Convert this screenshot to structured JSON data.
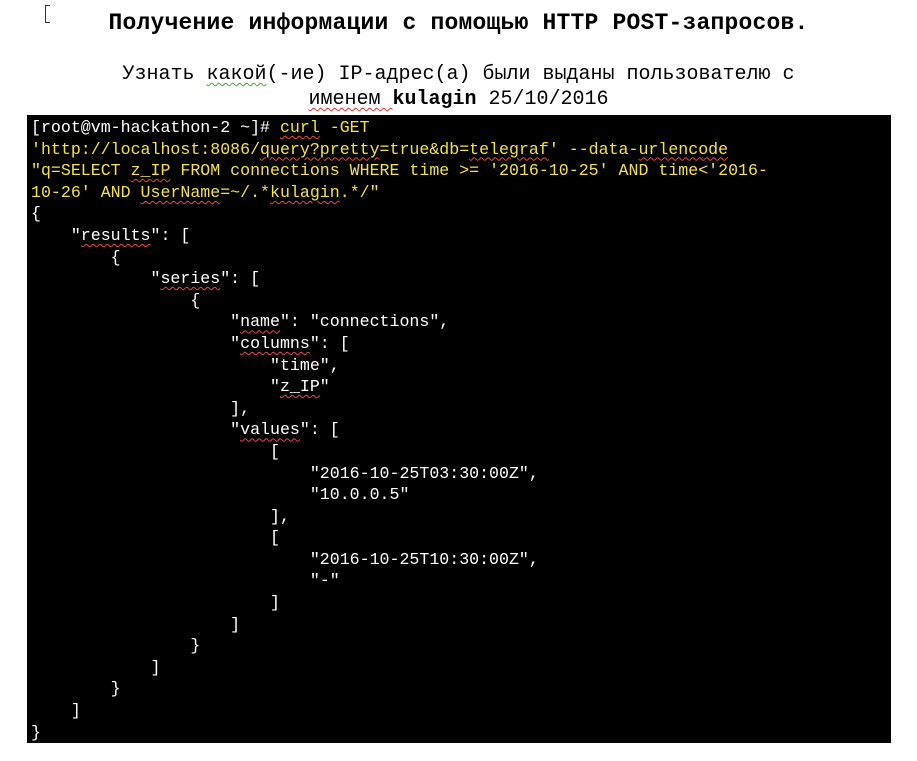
{
  "document": {
    "title": "Получение информации с помощью HTTP POST-запросов.",
    "subtitle": {
      "line1_prefix": "Узнать ",
      "line1_word": "какой",
      "line1_rest": "(-ие) IP-адрес(а) были выданы пользователю с",
      "line2_prefix": "именем ",
      "line2_user": "kulagin",
      "line2_date": " 25/10/2016"
    }
  },
  "terminal": {
    "prompt": "[root@vm-hackathon-2 ~]# ",
    "cmd_curl": "curl",
    "cmd_get": " -GET",
    "url_pre": "'http://localhost:8086/",
    "url_query": "query?pretty",
    "url_post": "=true&db=",
    "url_db": "telegraf",
    "url_end": "' --data-",
    "url_flag": "urlencode",
    "q_line1_a": "\"q=SELECT ",
    "q_line1_zip": "z_IP",
    "q_line1_b": " FROM connections WHERE time >= '2016-10-25' AND time<'2016-",
    "q_line2_a": "10-26' AND ",
    "q_line2_user": "UserName",
    "q_line2_b": "=~/.*",
    "q_line2_kul": "kulagin",
    "q_line2_c": ".*/\"",
    "out": {
      "l01": "{",
      "l02_a": "    \"",
      "l02_key": "results",
      "l02_b": "\": [",
      "l03": "        {",
      "l04_a": "            \"",
      "l04_key": "series",
      "l04_b": "\": [",
      "l05": "                {",
      "l06_a": "                    \"",
      "l06_key": "name",
      "l06_b": "\": \"connections\",",
      "l07_a": "                    \"",
      "l07_key": "columns",
      "l07_b": "\": [",
      "l08": "                        \"time\",",
      "l09_a": "                        \"",
      "l09_key": "z_IP",
      "l09_b": "\"",
      "l10": "                    ],",
      "l11_a": "                    \"",
      "l11_key": "values",
      "l11_b": "\": [",
      "l12": "                        [",
      "l13": "                            \"2016-10-25T03:30:00Z\",",
      "l14": "                            \"10.0.0.5\"",
      "l15": "                        ],",
      "l16": "                        [",
      "l17": "                            \"2016-10-25T10:30:00Z\",",
      "l18": "                            \"-\"",
      "l19": "                        ]",
      "l20": "                    ]",
      "l21": "                }",
      "l22": "            ]",
      "l23": "        }",
      "l24": "    ]",
      "l25": "}"
    }
  }
}
